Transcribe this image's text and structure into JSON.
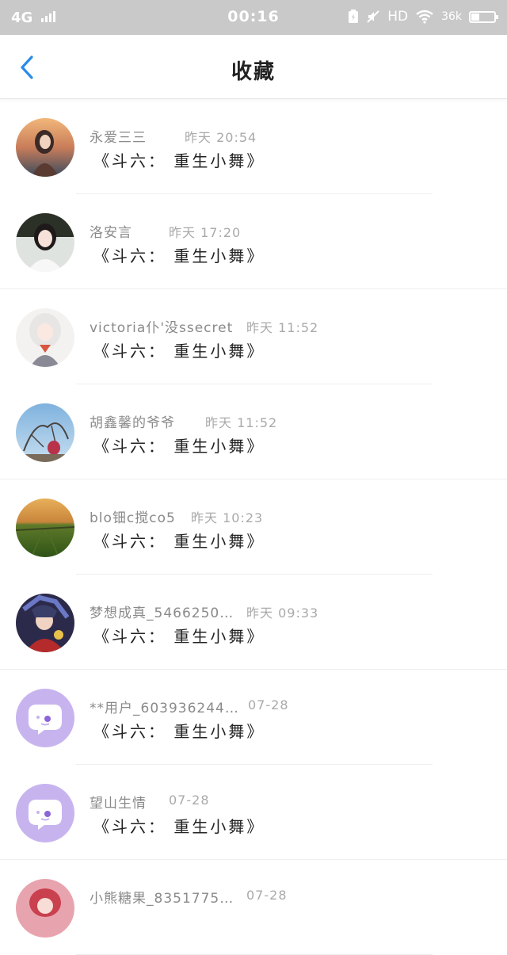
{
  "status_bar": {
    "network": "4G",
    "time": "00:16",
    "hd": "HD",
    "speed": "36k",
    "battery_level": 0.35
  },
  "header": {
    "title": "收藏",
    "back_icon": "chevron-left-icon",
    "accent_color": "#2b8be6"
  },
  "items": [
    {
      "name": "永爱三三",
      "time": "昨天 20:54",
      "book": "《斗六： 重生小舞》",
      "avatar": "photo-girl-sunset"
    },
    {
      "name": "洛安言",
      "time": "昨天 17:20",
      "book": "《斗六： 重生小舞》",
      "avatar": "photo-girl-white"
    },
    {
      "name": "victoria仆'没ssecret",
      "time": "昨天 11:52",
      "book": "《斗六： 重生小舞》",
      "avatar": "anime-girl-white-hair"
    },
    {
      "name": "胡鑫馨的爷爷",
      "time": "昨天 11:52",
      "book": "《斗六： 重生小舞》",
      "avatar": "photo-tree-sky"
    },
    {
      "name": "blo钿c搅co5",
      "time": "昨天 10:23",
      "book": "《斗六： 重生小舞》",
      "avatar": "photo-field-sunset"
    },
    {
      "name": "梦想成真_5466250…",
      "time": "昨天 09:33",
      "book": "《斗六： 重生小舞》",
      "avatar": "anime-character-red"
    },
    {
      "name": "**用户_603936244…",
      "time": "07-28",
      "book": "《斗六： 重生小舞》",
      "avatar": "default-chat-icon"
    },
    {
      "name": "望山生情",
      "time": "07-28",
      "book": "《斗六： 重生小舞》",
      "avatar": "default-chat-icon"
    },
    {
      "name": "小熊糖果_8351775…",
      "time": "07-28",
      "book": "",
      "avatar": "anime-character-pink"
    }
  ]
}
